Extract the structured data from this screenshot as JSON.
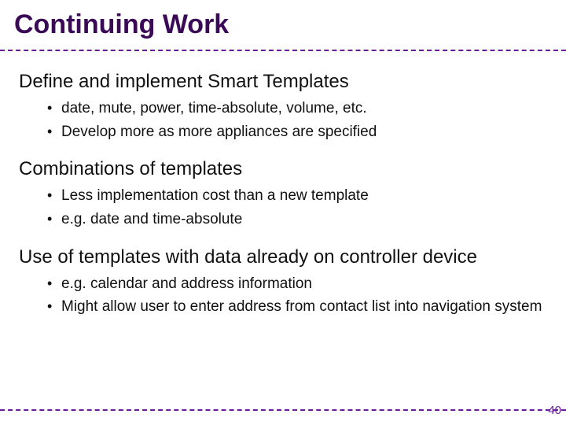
{
  "title": "Continuing Work",
  "sections": [
    {
      "head": "Define and implement Smart Templates",
      "bullets": [
        "date, mute, power, time-absolute, volume, etc.",
        "Develop more as more appliances are specified"
      ]
    },
    {
      "head": "Combinations of templates",
      "bullets": [
        "Less implementation cost than a new template",
        "e.g. date and time-absolute"
      ]
    },
    {
      "head": "Use of templates with data already on controller device",
      "bullets": [
        "e.g. calendar and address information",
        "Might allow user to enter address from contact list into navigation system"
      ]
    }
  ],
  "page_number": "40",
  "colors": {
    "accent": "#6a1b9a",
    "title": "#3b0a57"
  }
}
